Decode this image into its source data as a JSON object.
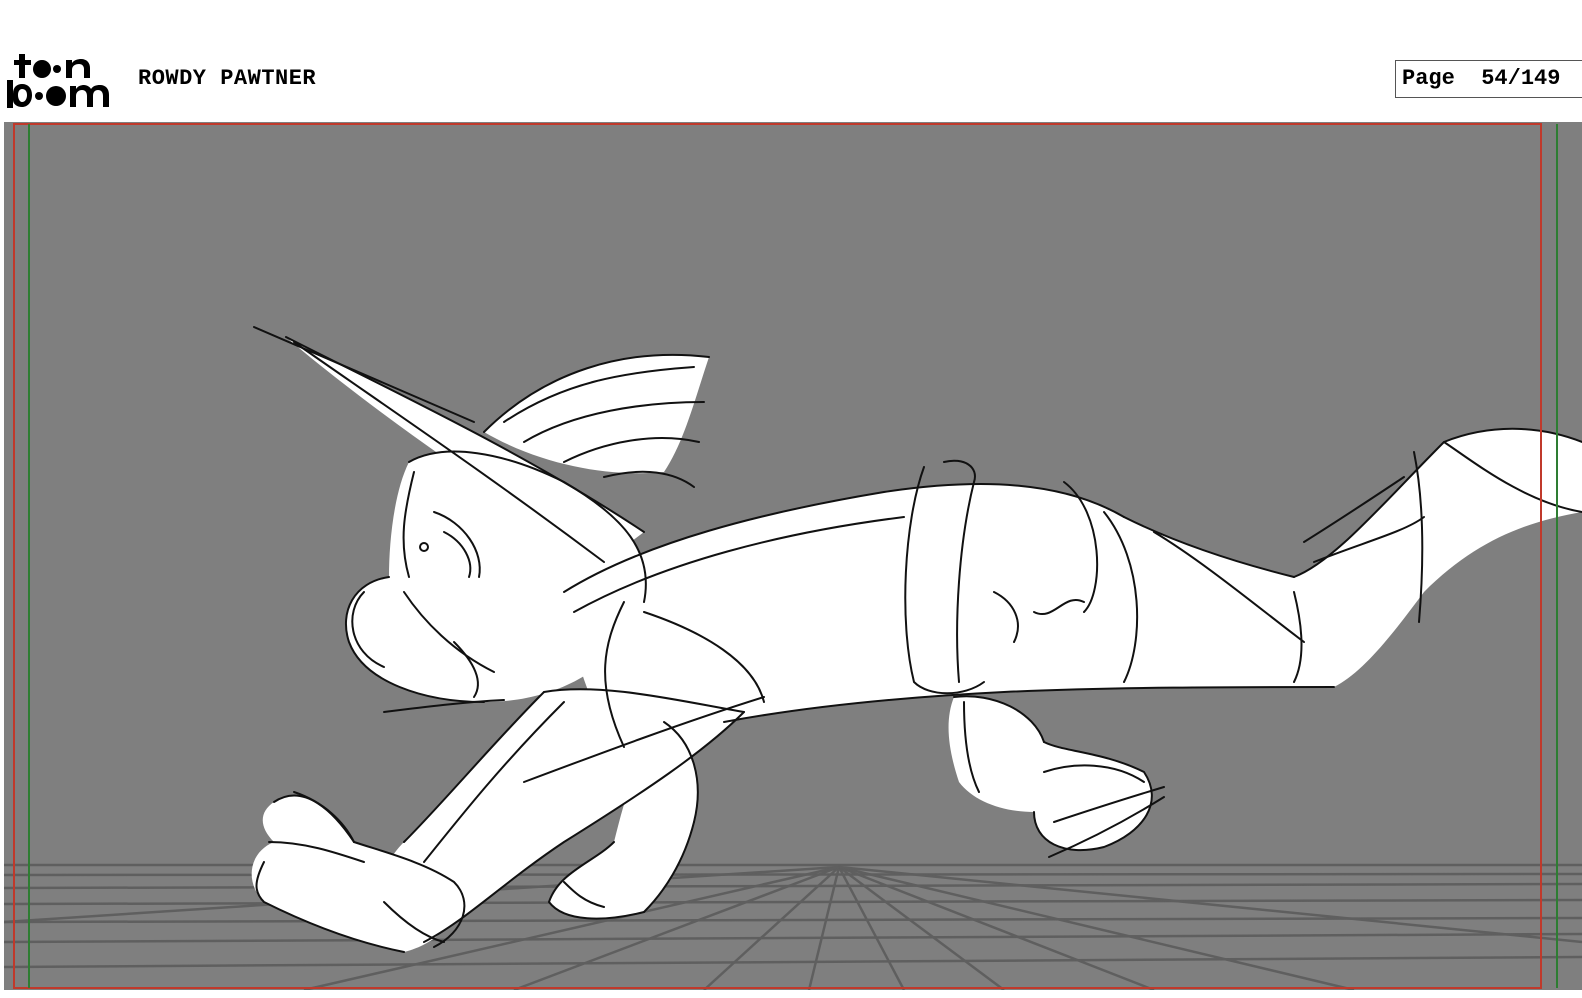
{
  "header": {
    "logo_text_top": "toon",
    "logo_text_bottom": "boom",
    "project_title": "ROWDY PAWTNER",
    "page_label": "Page",
    "page_number": "54/149"
  },
  "panel": {
    "background_color": "#7f7f7f",
    "safe_frame_color": "#c0392b",
    "title_safe_color": "#2e7d32",
    "sketch_line_color": "#111111",
    "fill_color": "#ffffff",
    "perspective_grid_color": "#5a5a5a",
    "subject": "character-running-sketch"
  }
}
